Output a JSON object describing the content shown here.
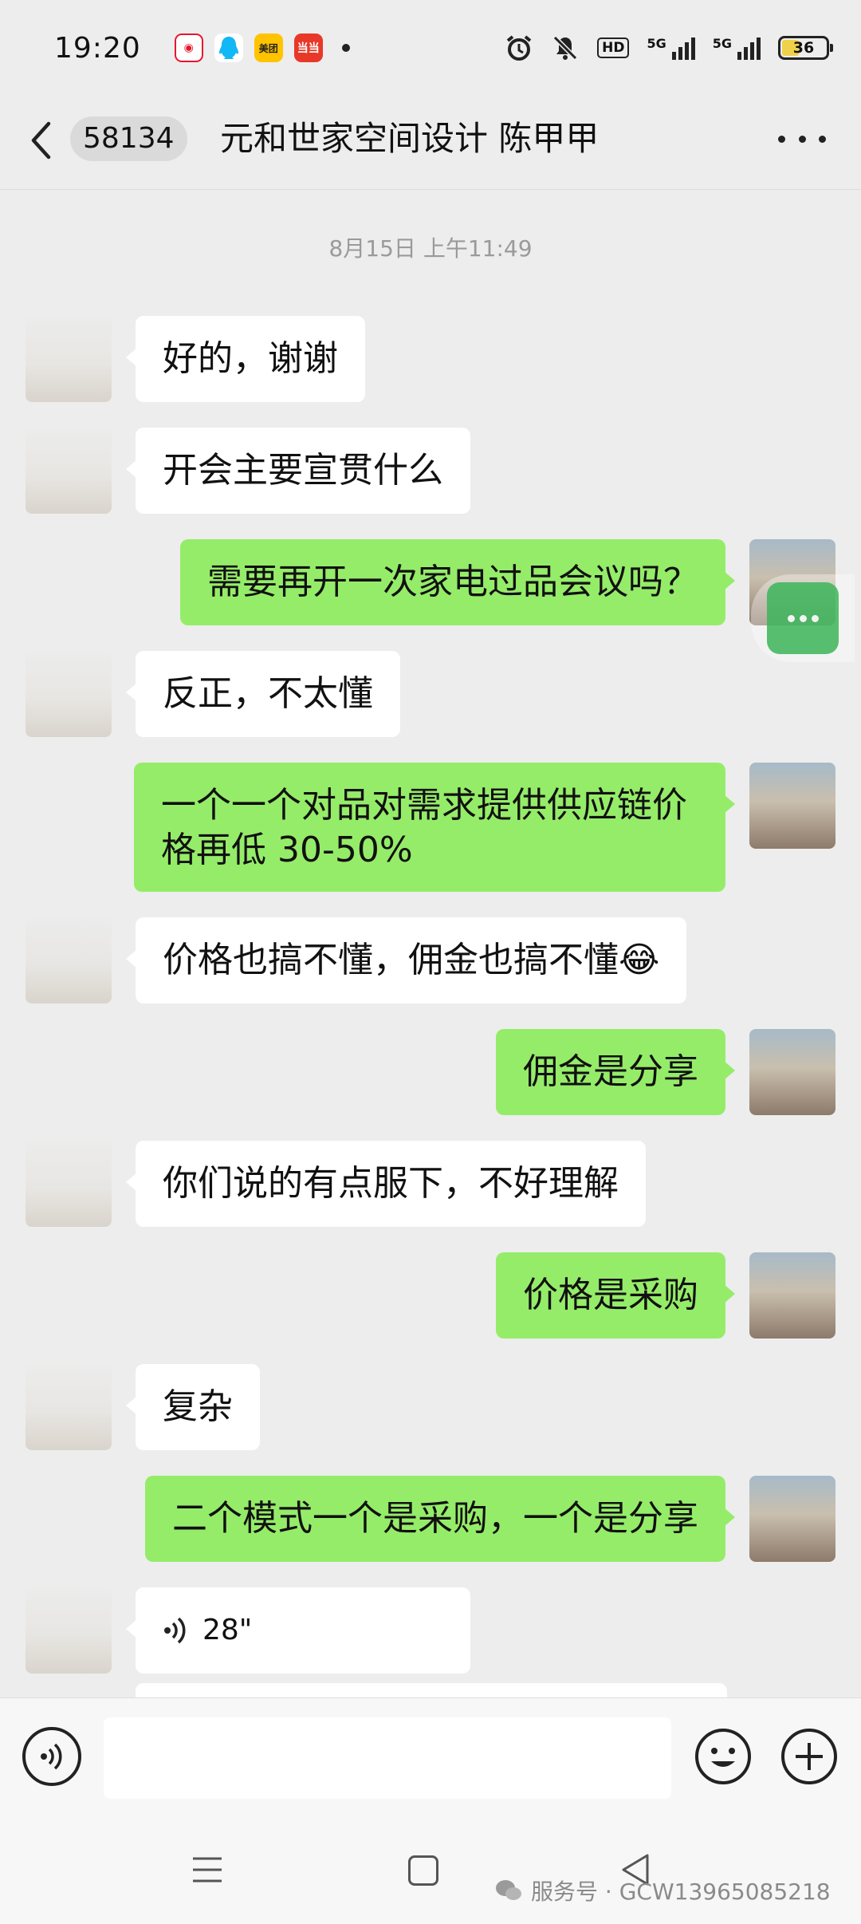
{
  "status_bar": {
    "time": "19:20",
    "app_icons": [
      "weibo-icon",
      "qq-icon",
      "meituan-icon",
      "dangdang-icon"
    ],
    "app_labels": {
      "meituan": "美团",
      "dangdang": "当当"
    },
    "network_label_1": "5G",
    "network_label_2": "5G",
    "hd_label": "HD",
    "battery": "36",
    "battery_level": 0.36
  },
  "header": {
    "unread_count": "58134",
    "title": "元和世家空间设计 陈甲甲"
  },
  "timestamp": "8月15日 上午11:49",
  "messages": [
    {
      "side": "left",
      "text": "好的，谢谢"
    },
    {
      "side": "left",
      "text": "开会主要宣贯什么"
    },
    {
      "side": "right",
      "text": "需要再开一次家电过品会议吗？"
    },
    {
      "side": "left",
      "text": "反正，不太懂"
    },
    {
      "side": "right",
      "text": "一个一个对品对需求提供供应链价格再低 30-50%"
    },
    {
      "side": "left",
      "text": "价格也搞不懂，佣金也搞不懂",
      "emoji": "😂"
    },
    {
      "side": "right",
      "text": "佣金是分享"
    },
    {
      "side": "left",
      "text": "你们说的有点服下，不好理解"
    },
    {
      "side": "right",
      "text": "价格是采购"
    },
    {
      "side": "left",
      "text": "复杂"
    },
    {
      "side": "right",
      "text": "二个模式一个是采购，一个是分享"
    },
    {
      "side": "left",
      "type": "voice",
      "duration": "28\""
    }
  ],
  "input": {
    "placeholder": ""
  },
  "watermark": "服务号 · GCW13965085218",
  "colors": {
    "sent_bubble": "#95ec69",
    "received_bubble": "#ffffff",
    "background": "#ededed"
  }
}
